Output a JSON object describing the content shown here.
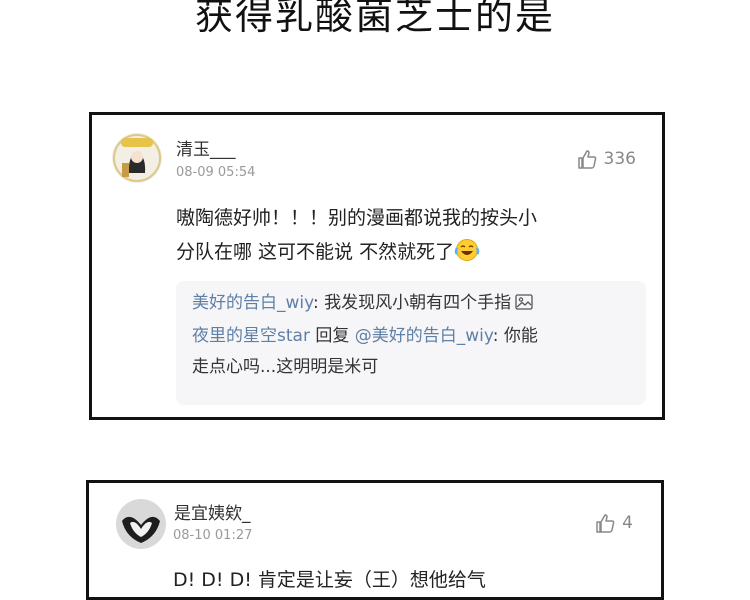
{
  "page_title": "获得乳酸菌芝士的是",
  "comments": [
    {
      "username": "清玉___",
      "timestamp": "08-09 05:54",
      "likes": "336",
      "content_line1": "嗷陶德好帅！！！别的漫画都说我的按头小",
      "content_line2": "分队在哪  这可不能说  不然就死了",
      "emoji_icon": "laughing-tears-emoji",
      "replies": {
        "r1_author": "美好的告白_wiy",
        "r1_sep": ": ",
        "r1_text": "我发现风小朝有四个手指",
        "r1_icon": "image-icon",
        "r2_author": "夜里的星空star",
        "r2_action": " 回复 ",
        "r2_target": "@美好的告白_wiy",
        "r2_sep": ": ",
        "r2_text_a": "你能",
        "r2_text_b": "走点心吗...这明明是米可"
      }
    },
    {
      "username": "是宜姨欸_",
      "timestamp": "08-10 01:27",
      "likes": "4",
      "content_line1": "D!  D!  D!  肯定是让妄（王）想他给气"
    }
  ],
  "colors": {
    "link_blue": "#5e7fa6",
    "card_border": "#111111",
    "reply_bg": "#f6f6f8"
  }
}
